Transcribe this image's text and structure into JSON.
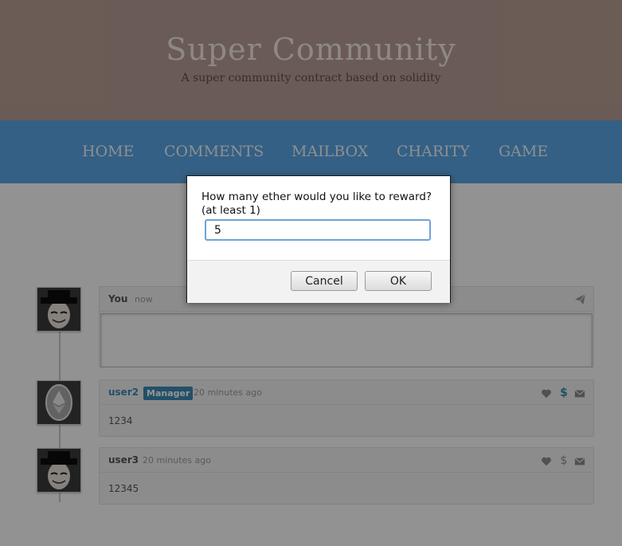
{
  "site": {
    "title": "Super Community",
    "subtitle": "A super community contract based on solidity"
  },
  "nav": {
    "items": [
      {
        "label": "HOME"
      },
      {
        "label": "COMMENTS"
      },
      {
        "label": "MAILBOX"
      },
      {
        "label": "CHARITY"
      },
      {
        "label": "GAME"
      }
    ]
  },
  "compose": {
    "author": "You",
    "time": "now",
    "send_icon": "send-icon"
  },
  "comments": [
    {
      "author": "user2",
      "badge": "Manager",
      "time": "20 minutes ago",
      "text": "1234",
      "avatar": "coin-avatar"
    },
    {
      "author": "user3",
      "badge": "",
      "time": "20 minutes ago",
      "text": "12345",
      "avatar": "mask-avatar"
    }
  ],
  "dialog": {
    "message": "How many ether would you like to reward?\n(at least 1)",
    "input_value": "5",
    "cancel_label": "Cancel",
    "ok_label": "OK"
  },
  "colors": {
    "header_bg": "#b89e95",
    "nav_bg": "#5aa6e6",
    "author": "#3b8bb6",
    "badge_bg": "#3b8bb6"
  }
}
